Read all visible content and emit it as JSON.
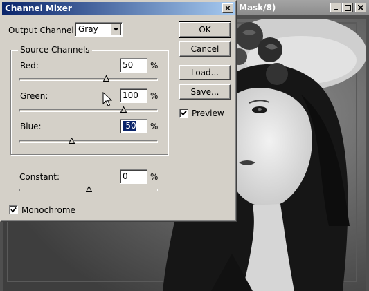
{
  "background_window": {
    "title": "Mask/8)",
    "buttons": {
      "minimize": "_",
      "maximize": "□",
      "close": "×"
    }
  },
  "dialog": {
    "title": "Channel Mixer",
    "close_label": "×",
    "output_channel": {
      "label": "Output Channel:",
      "value": "Gray"
    },
    "source_channels": {
      "label": "Source Channels",
      "channels": [
        {
          "name": "Red:",
          "value": "50",
          "unit": "%",
          "slider": 0.625
        },
        {
          "name": "Green:",
          "value": "100",
          "unit": "%",
          "slider": 0.75
        },
        {
          "name": "Blue:",
          "value": "-50",
          "unit": "%",
          "slider": 0.375
        }
      ]
    },
    "constant": {
      "label": "Constant:",
      "value": "0",
      "unit": "%",
      "slider": 0.5
    },
    "monochrome": {
      "label": "Monochrome",
      "checked": true
    },
    "buttons": {
      "ok": "OK",
      "cancel": "Cancel",
      "load": "Load...",
      "save": "Save..."
    },
    "preview": {
      "label": "Preview",
      "checked": true
    }
  },
  "colors": {
    "title_start": "#0a246a",
    "title_end": "#a6caf0",
    "face": "#d4d0c8"
  }
}
